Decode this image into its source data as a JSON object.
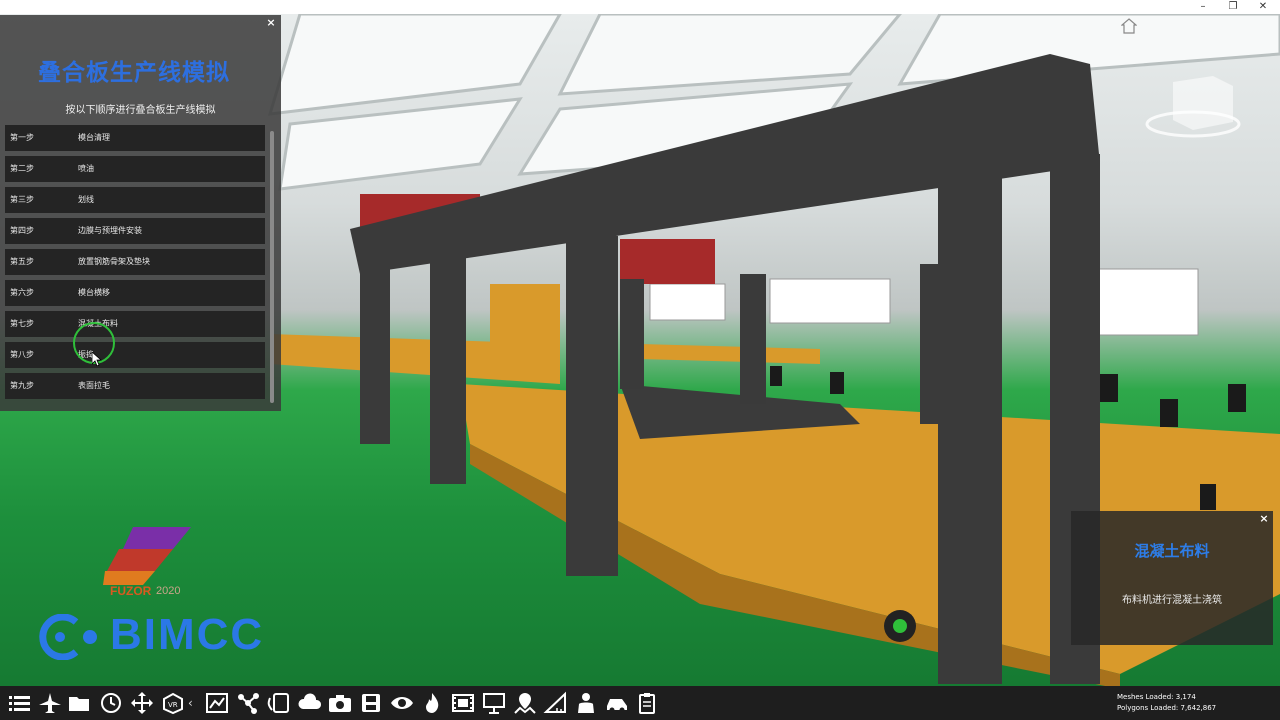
{
  "window": {
    "minimize_icon": "–",
    "maximize_icon": "❐",
    "close_icon": "✕"
  },
  "panel": {
    "title": "叠合板生产线模拟",
    "subtitle": "按以下顺序进行叠合板生产线模拟",
    "close_icon": "×",
    "steps": [
      {
        "num": "第一步",
        "name": "模台清理"
      },
      {
        "num": "第二步",
        "name": "喷油"
      },
      {
        "num": "第三步",
        "name": "划线"
      },
      {
        "num": "第四步",
        "name": "边膜与预埋件安装"
      },
      {
        "num": "第五步",
        "name": "放置钢筋骨架及垫块"
      },
      {
        "num": "第六步",
        "name": "模台横移"
      },
      {
        "num": "第七步",
        "name": "混凝土布料"
      },
      {
        "num": "第八步",
        "name": "振捣"
      },
      {
        "num": "第九步",
        "name": "表面拉毛"
      }
    ]
  },
  "info": {
    "title": "混凝土布料",
    "description": "布料机进行混凝土浇筑",
    "close_icon": "×"
  },
  "logos": {
    "fuzor": "FUZOR",
    "fuzor_year": "2020",
    "bimcc": "BIMCC"
  },
  "toolbar": {
    "chevron": "‹",
    "icons": [
      "menu-icon",
      "airplane-icon",
      "folder-icon",
      "clock-icon",
      "move-icon",
      "vr-icon",
      "frame-select-icon",
      "network-icon",
      "phone-book-icon",
      "cloud-sync-icon",
      "camera-icon",
      "save-disk-icon",
      "eye-icon",
      "fire-icon",
      "film-icon",
      "presentation-icon",
      "map-pin-icon",
      "measure-icon",
      "person-icon",
      "car-icon",
      "clipboard-icon"
    ]
  },
  "stats": {
    "meshes": "Meshes Loaded: 3,174",
    "polygons": "Polygons Loaded: 7,642,867"
  }
}
